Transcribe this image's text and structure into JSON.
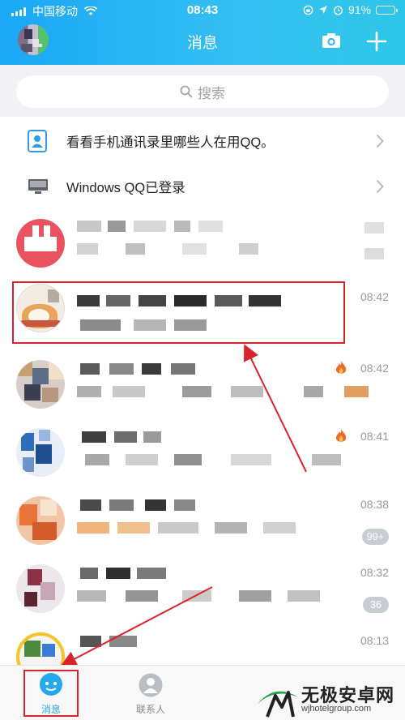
{
  "status_bar": {
    "carrier": "中国移动",
    "time": "08:43",
    "battery": "91%",
    "battery_level": 0.91
  },
  "header": {
    "title": "消息"
  },
  "search": {
    "placeholder": "搜索"
  },
  "system_rows": [
    {
      "label": "看看手机通讯录里哪些人在用QQ。",
      "icon": "contacts-icon"
    },
    {
      "label": "Windows QQ已登录",
      "icon": "monitor-icon"
    }
  ],
  "chats": [
    {
      "time": "08:42",
      "highlighted": true,
      "preview": ""
    },
    {
      "time": "08:42",
      "fire": true
    },
    {
      "time": "08:41",
      "fire": true
    },
    {
      "time": "08:38",
      "badge": "99+"
    },
    {
      "time": "08:32",
      "badge": "36"
    },
    {
      "time": "08:13"
    }
  ],
  "tabbar": {
    "messages_label": "消息",
    "contacts_label": "联系人"
  },
  "watermark": {
    "title": "无极安卓网",
    "url": "wjhotelgroup.com"
  },
  "colors": {
    "header_start": "#1aa7f5",
    "header_end": "#2ec6e8",
    "annotation_red": "#d9242b",
    "badge_grey": "#c8ccd3"
  }
}
